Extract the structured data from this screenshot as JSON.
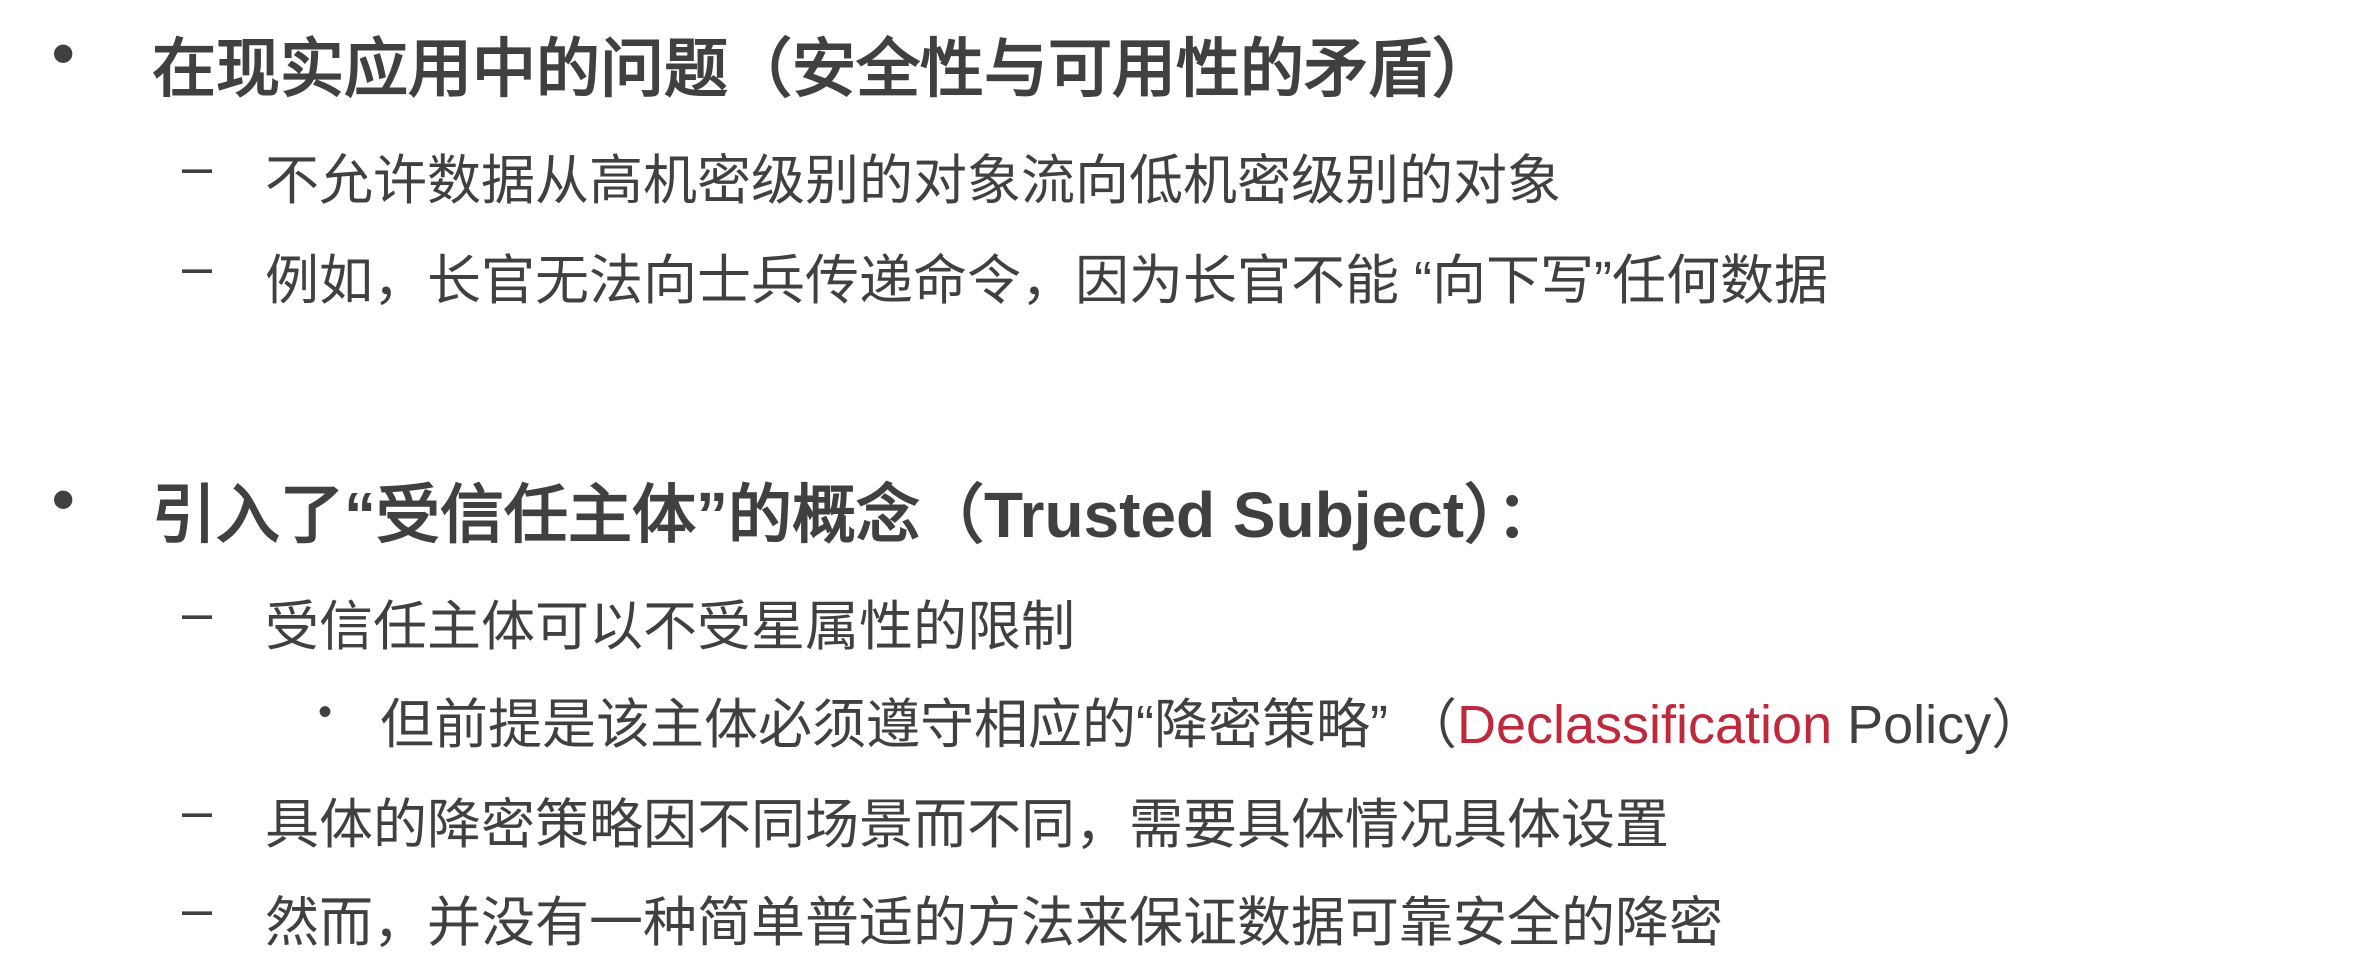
{
  "slide": {
    "section1": {
      "bullet": "•",
      "title": "在现实应用中的问题（安全性与可用性的矛盾）",
      "items": [
        {
          "dash": "–",
          "text": "不允许数据从高机密级别的对象流向低机密级别的对象"
        },
        {
          "dash": "–",
          "text": "例如，长官无法向士兵传递命令，因为长官不能 “向下写”任何数据"
        }
      ]
    },
    "section2": {
      "bullet": "•",
      "title": "引入了“受信任主体”的概念（Trusted Subject）：",
      "items": [
        {
          "dash": "–",
          "text": "受信任主体可以不受星属性的限制"
        },
        {
          "sub_bullet": "•",
          "text_before": "但前提是该主体必须遵守相应的“降密策略” （",
          "highlight": "Declassification",
          "text_after": " Policy）"
        },
        {
          "dash": "–",
          "text": "具体的降密策略因不同场景而不同，需要具体情况具体设置"
        },
        {
          "dash": "–",
          "text": "然而，并没有一种简单普适的方法来保证数据可靠安全的降密"
        }
      ]
    },
    "colors": {
      "text": "#404040",
      "highlight": "#c0283c",
      "background": "#ffffff"
    }
  }
}
